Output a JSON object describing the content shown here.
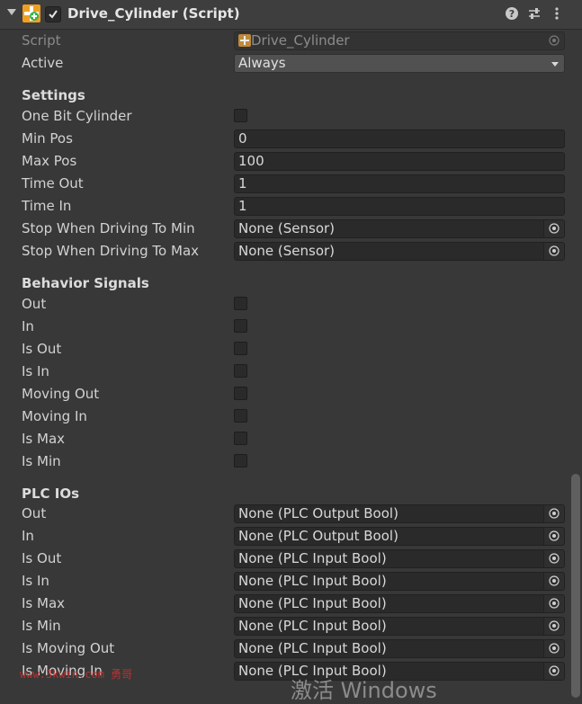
{
  "header": {
    "title": "Drive_Cylinder (Script)",
    "enabled": true
  },
  "script_row": {
    "label": "Script",
    "value": "Drive_Cylinder"
  },
  "active_row": {
    "label": "Active",
    "value": "Always"
  },
  "settings": {
    "heading": "Settings",
    "one_bit_cylinder": {
      "label": "One Bit Cylinder",
      "checked": false
    },
    "min_pos": {
      "label": "Min Pos",
      "value": "0"
    },
    "max_pos": {
      "label": "Max Pos",
      "value": "100"
    },
    "time_out": {
      "label": "Time Out",
      "value": "1"
    },
    "time_in": {
      "label": "Time In",
      "value": "1"
    },
    "stop_min": {
      "label": "Stop When Driving To Min",
      "value": "None (Sensor)"
    },
    "stop_max": {
      "label": "Stop When Driving To Max",
      "value": "None (Sensor)"
    }
  },
  "behavior": {
    "heading": "Behavior Signals",
    "items": [
      {
        "label": "Out",
        "checked": false
      },
      {
        "label": "In",
        "checked": false
      },
      {
        "label": "Is Out",
        "checked": false
      },
      {
        "label": "Is In",
        "checked": false
      },
      {
        "label": "Moving Out",
        "checked": false
      },
      {
        "label": "Moving In",
        "checked": false
      },
      {
        "label": "Is Max",
        "checked": false
      },
      {
        "label": "Is Min",
        "checked": false
      }
    ]
  },
  "plc": {
    "heading": "PLC IOs",
    "items": [
      {
        "label": "Out",
        "value": "None (PLC Output Bool)"
      },
      {
        "label": "In",
        "value": "None (PLC Output Bool)"
      },
      {
        "label": "Is Out",
        "value": "None (PLC Input Bool)"
      },
      {
        "label": "Is In",
        "value": "None (PLC Input Bool)"
      },
      {
        "label": "Is Max",
        "value": "None (PLC Input Bool)"
      },
      {
        "label": "Is Min",
        "value": "None (PLC Input Bool)"
      },
      {
        "label": "Is Moving Out",
        "value": "None (PLC Input Bool)"
      },
      {
        "label": "Is Moving In",
        "value": "None (PLC Input Bool)"
      }
    ]
  },
  "overlay": {
    "watermark": "www.3kwin.com 勇哥",
    "activate_windows": "激活 Windows"
  },
  "colors": {
    "background": "#383838",
    "field": "#2a2a2a",
    "text": "#d2d2d2"
  }
}
